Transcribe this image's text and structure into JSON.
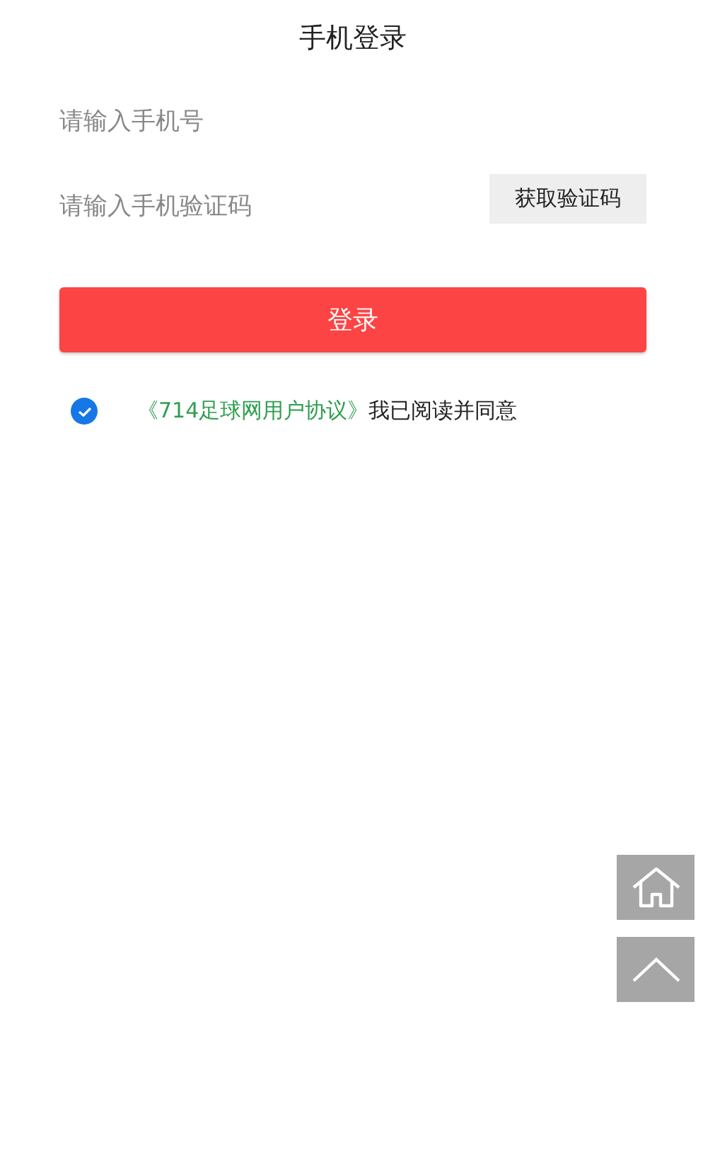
{
  "title": "手机登录",
  "phone_field": {
    "placeholder": "请输入手机号"
  },
  "code_field": {
    "placeholder": "请输入手机验证码"
  },
  "get_code_button": "获取验证码",
  "login_button": "登录",
  "agreement": {
    "checked": true,
    "link": "《714足球网用户协议》",
    "text": "我已阅读并同意"
  }
}
